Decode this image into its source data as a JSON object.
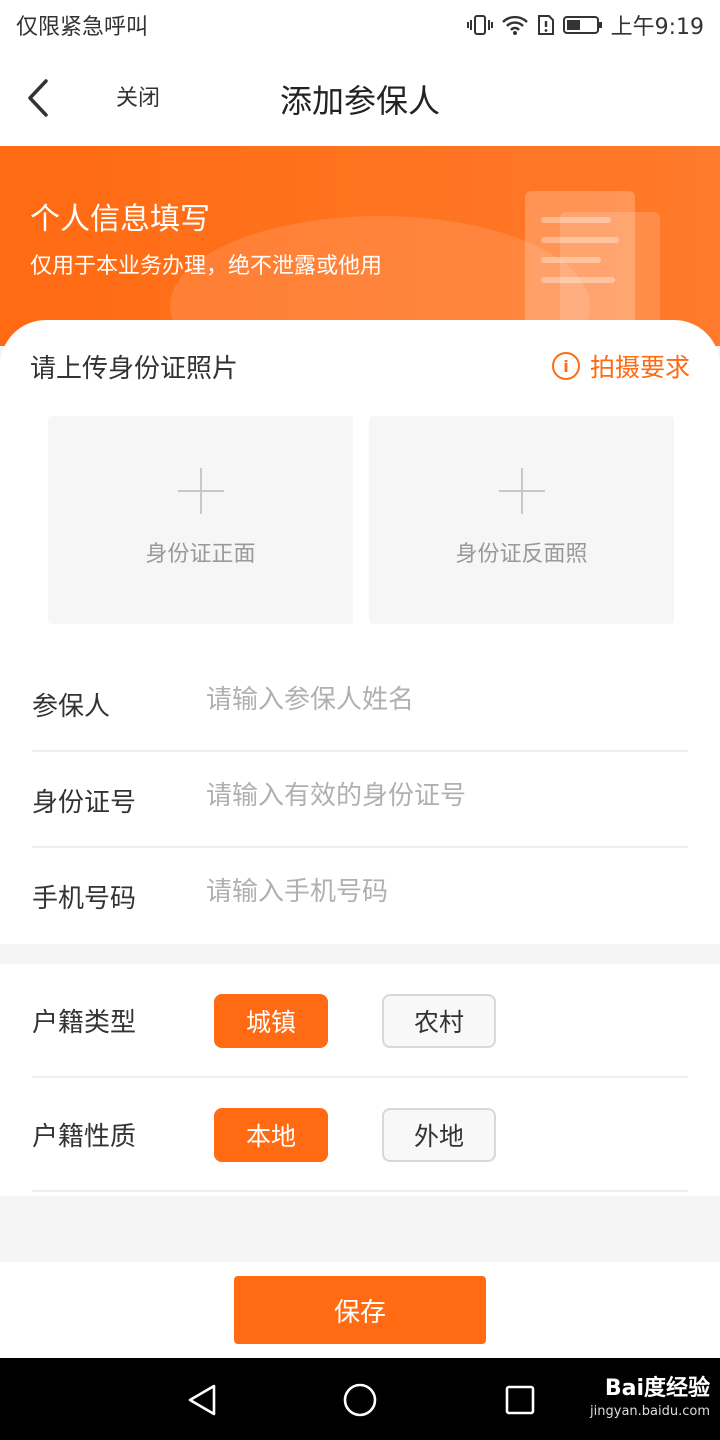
{
  "status_bar": {
    "carrier": "仅限紧急呼叫",
    "time": "上午9:19",
    "battery_level": 0.45
  },
  "nav": {
    "back_icon": "chevron-left-icon",
    "close_label": "关闭",
    "title": "添加参保人"
  },
  "banner": {
    "title": "个人信息填写",
    "subtitle": "仅用于本业务办理，绝不泄露或他用"
  },
  "upload": {
    "title": "请上传身份证照片",
    "requirement_label": "拍摄要求",
    "front_label": "身份证正面",
    "back_label": "身份证反面照"
  },
  "form": {
    "name": {
      "label": "参保人",
      "placeholder": "请输入参保人姓名",
      "value": ""
    },
    "id_number": {
      "label": "身份证号",
      "placeholder": "请输入有效的身份证号",
      "value": ""
    },
    "phone": {
      "label": "手机号码",
      "placeholder": "请输入手机号码",
      "value": ""
    }
  },
  "household": {
    "type": {
      "label": "户籍类型",
      "options": [
        "城镇",
        "农村"
      ],
      "selected": "城镇"
    },
    "nature": {
      "label": "户籍性质",
      "options": [
        "本地",
        "外地"
      ],
      "selected": "本地"
    }
  },
  "save_label": "保存",
  "watermark": {
    "logo": "Bai度经验",
    "url": "jingyan.baidu.com"
  },
  "colors": {
    "accent": "#ff6a12",
    "placeholder": "#b0b0b0",
    "background": "#f5f5f5"
  }
}
